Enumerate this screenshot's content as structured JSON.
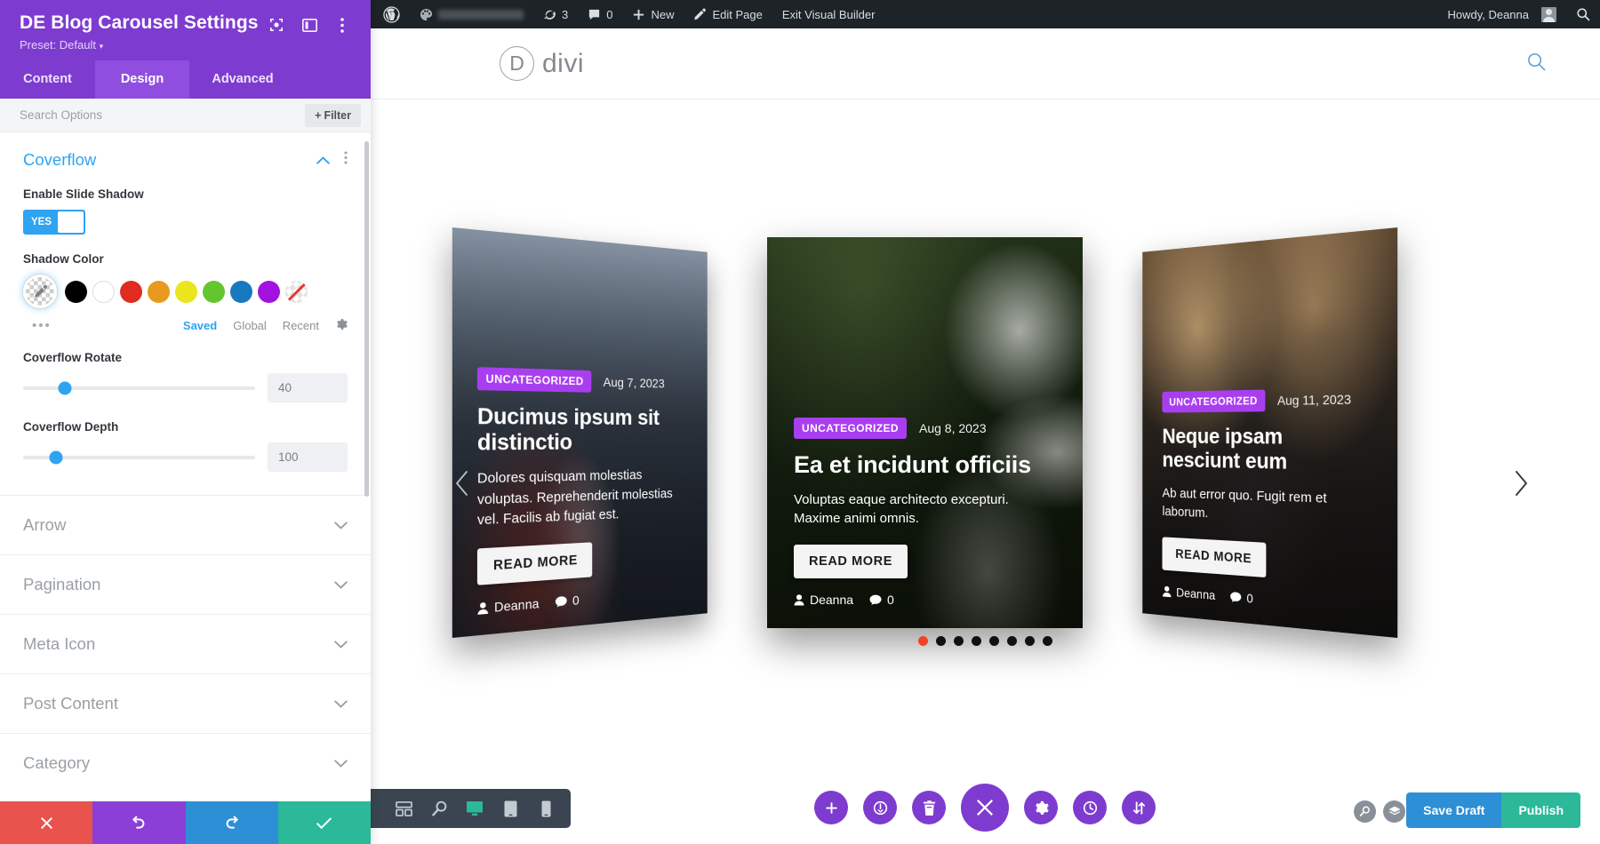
{
  "settings_panel": {
    "title": "DE Blog Carousel Settings",
    "preset": "Preset: Default",
    "header_icons": [
      "focus-icon",
      "layout-icon",
      "kebab-menu-icon"
    ],
    "tabs": [
      {
        "label": "Content",
        "active": false
      },
      {
        "label": "Design",
        "active": true
      },
      {
        "label": "Advanced",
        "active": false
      }
    ],
    "search": {
      "placeholder": "Search Options",
      "value": ""
    },
    "filter_label": "Filter",
    "open_section": {
      "title": "Coverflow",
      "fields": {
        "enable_slide_shadow": {
          "label": "Enable Slide Shadow",
          "toggle": "YES"
        },
        "shadow_color": {
          "label": "Shadow Color",
          "swatches": [
            "transparent-picker",
            "#000000",
            "#ffffff",
            "#e02b20",
            "#e79a1e",
            "#eae51c",
            "#63c62f",
            "#1878c0",
            "#a211e0",
            "none"
          ],
          "more_label": "•••",
          "tabs": [
            {
              "label": "Saved",
              "active": true
            },
            {
              "label": "Global",
              "active": false
            },
            {
              "label": "Recent",
              "active": false
            }
          ]
        },
        "coverflow_rotate": {
          "label": "Coverflow Rotate",
          "value": "40",
          "percent": 18
        },
        "coverflow_depth": {
          "label": "Coverflow Depth",
          "value": "100",
          "percent": 14
        }
      }
    },
    "closed_sections": [
      {
        "label": "Arrow"
      },
      {
        "label": "Pagination"
      },
      {
        "label": "Meta Icon"
      },
      {
        "label": "Post Content"
      },
      {
        "label": "Category"
      }
    ],
    "actions": [
      {
        "name": "cancel",
        "icon": "close-icon"
      },
      {
        "name": "undo",
        "icon": "undo-icon"
      },
      {
        "name": "redo",
        "icon": "redo-icon"
      },
      {
        "name": "save",
        "icon": "check-icon"
      }
    ]
  },
  "wp_admin_bar": {
    "logo": "wordpress-icon",
    "site_name": "",
    "updates_count": "3",
    "comments_count": "0",
    "new_label": "New",
    "edit_page_label": "Edit Page",
    "exit_builder_label": "Exit Visual Builder",
    "howdy": "Howdy, Deanna"
  },
  "site": {
    "logo_letter": "D",
    "logo_word": "divi",
    "search_icon": "search-icon"
  },
  "carousel": {
    "prev_icon": "chevron-left-icon",
    "next_icon": "chevron-right-icon",
    "slides": [
      {
        "category": "UNCATEGORIZED",
        "date": "Aug 7, 2023",
        "title": "Ducimus ipsum sit distinctio",
        "excerpt": "Dolores quisquam molestias voluptas. Reprehenderit molestias vel. Facilis ab fugiat est.",
        "button": "READ MORE",
        "author": "Deanna",
        "comments": "0"
      },
      {
        "category": "UNCATEGORIZED",
        "date": "Aug 8, 2023",
        "title": "Ea et incidunt officiis",
        "excerpt": "Voluptas eaque architecto excepturi. Maxime animi omnis.",
        "button": "READ MORE",
        "author": "Deanna",
        "comments": "0"
      },
      {
        "category": "UNCATEGORIZED",
        "date": "Aug 11, 2023",
        "title": "Neque ipsam nesciunt eum",
        "excerpt": "Ab aut error quo. Fugit rem et laborum.",
        "button": "READ MORE",
        "author": "Deanna",
        "comments": "0"
      }
    ],
    "pagination": {
      "count": 8,
      "active_index": 0,
      "active_color": "#ef4323",
      "dot_color": "#111111"
    }
  },
  "builder_toolbar": {
    "left_tools": [
      {
        "name": "more-options",
        "icon": "vertical-dots-icon",
        "active": false
      },
      {
        "name": "wireframe-view",
        "icon": "wireframe-icon",
        "active": false
      },
      {
        "name": "zoom-view",
        "icon": "magnifier-icon",
        "active": false
      },
      {
        "name": "desktop-view",
        "icon": "desktop-icon",
        "active": true
      },
      {
        "name": "tablet-view",
        "icon": "tablet-icon",
        "active": false
      },
      {
        "name": "phone-view",
        "icon": "phone-icon",
        "active": false
      }
    ],
    "center_tools": [
      {
        "name": "add-section",
        "icon": "plus-icon",
        "big": false
      },
      {
        "name": "page-settings",
        "icon": "power-icon",
        "big": false
      },
      {
        "name": "delete",
        "icon": "trash-icon",
        "big": false
      },
      {
        "name": "close-builder",
        "icon": "close-icon",
        "big": true
      },
      {
        "name": "settings",
        "icon": "gear-icon",
        "big": false
      },
      {
        "name": "history",
        "icon": "clock-icon",
        "big": false
      },
      {
        "name": "reorder",
        "icon": "arrows-updown-icon",
        "big": false
      }
    ],
    "right_tools": [
      {
        "name": "search",
        "icon": "magnifier-icon"
      },
      {
        "name": "layers",
        "icon": "layers-icon"
      },
      {
        "name": "help",
        "icon": "question-icon"
      }
    ],
    "save_draft_label": "Save Draft",
    "publish_label": "Publish"
  },
  "colors": {
    "purple": "#7e3bd0",
    "tab_active": "#8f4ee0",
    "blue": "#2ea3f2",
    "green": "#2bb99a",
    "badge_purple": "#a93ef0",
    "admin_dark": "#1e2327"
  }
}
